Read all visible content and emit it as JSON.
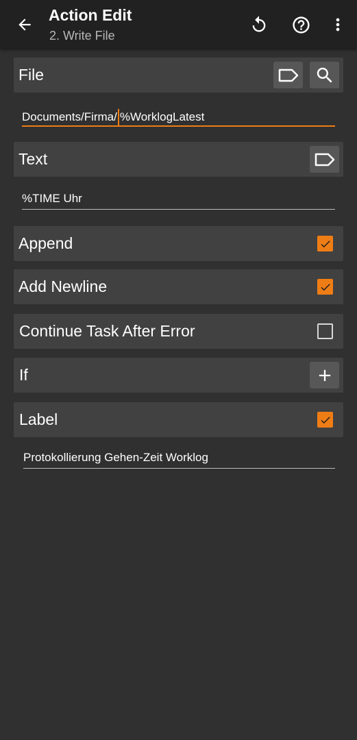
{
  "appbar": {
    "title": "Action Edit",
    "subtitle": "2. Write File",
    "icons": [
      "back-arrow-icon",
      "undo-icon",
      "help-icon",
      "more-vert-icon"
    ]
  },
  "file": {
    "label": "File",
    "value_before_cursor": "Documents/Firma/",
    "value_after_cursor": "%WorklogLatest"
  },
  "text": {
    "label": "Text",
    "value": "%TIME Uhr"
  },
  "append": {
    "label": "Append",
    "checked": true
  },
  "add_newline": {
    "label": "Add Newline",
    "checked": true
  },
  "continue_after_error": {
    "label": "Continue Task After Error",
    "checked": false
  },
  "if_section": {
    "label": "If"
  },
  "label_section": {
    "label": "Label",
    "checked": true,
    "value": "Protokollierung Gehen-Zeit Worklog"
  },
  "colors": {
    "accent": "#ef7d15",
    "background": "#303030",
    "appbar": "#212121",
    "row": "#414141",
    "button": "#575757"
  }
}
